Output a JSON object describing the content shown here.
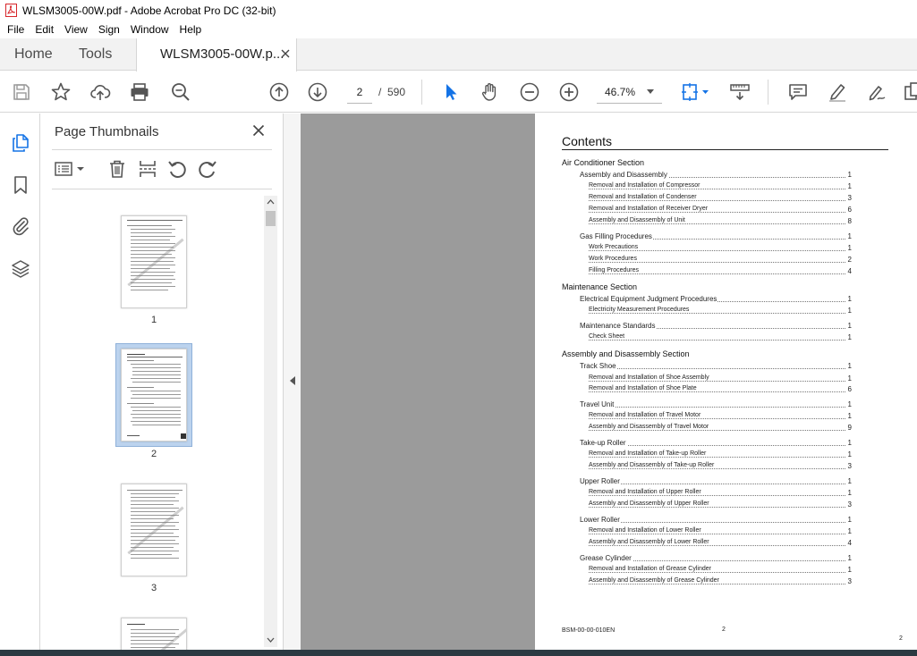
{
  "window": {
    "title": "WLSM3005-00W.pdf - Adobe Acrobat Pro DC (32-bit)"
  },
  "menu": [
    "File",
    "Edit",
    "View",
    "Sign",
    "Window",
    "Help"
  ],
  "tabs": {
    "home": "Home",
    "tools": "Tools",
    "document": "WLSM3005-00W.p..."
  },
  "toolbar": {
    "page_current": "2",
    "page_sep": "/",
    "page_total": "590",
    "zoom": "46.7%"
  },
  "panel": {
    "title": "Page Thumbnails",
    "thumbnails": [
      {
        "label": "1"
      },
      {
        "label": "2",
        "selected": true
      },
      {
        "label": "3"
      }
    ]
  },
  "document": {
    "heading": "Contents",
    "toc": [
      {
        "level": 0,
        "title": "Air Conditioner Section",
        "page": ""
      },
      {
        "level": 1,
        "title": "Assembly and Disassembly",
        "page": "1"
      },
      {
        "level": 2,
        "title": "Removal and Installation of Compressor",
        "page": "1"
      },
      {
        "level": 2,
        "title": "Removal and Installation of Condenser",
        "page": "3"
      },
      {
        "level": 2,
        "title": "Removal and Installation of Receiver Dryer",
        "page": "6"
      },
      {
        "level": 2,
        "title": "Assembly and Disassembly of Unit",
        "page": "8"
      },
      {
        "level": 1,
        "title": "Gas Filling Procedures",
        "page": "1"
      },
      {
        "level": 2,
        "title": "Work Precautions",
        "page": "1"
      },
      {
        "level": 2,
        "title": "Work Procedures",
        "page": "2"
      },
      {
        "level": 2,
        "title": "Filling Procedures",
        "page": "4"
      },
      {
        "level": 0,
        "title": "Maintenance Section",
        "page": ""
      },
      {
        "level": 1,
        "title": "Electrical Equipment Judgment Procedures",
        "page": "1"
      },
      {
        "level": 2,
        "title": "Electricity Measurement Procedures",
        "page": "1"
      },
      {
        "level": 1,
        "title": "Maintenance Standards",
        "page": "1"
      },
      {
        "level": 2,
        "title": "Check Sheet",
        "page": "1"
      },
      {
        "level": 0,
        "title": "Assembly and Disassembly Section",
        "page": ""
      },
      {
        "level": 1,
        "title": "Track Shoe",
        "page": "1"
      },
      {
        "level": 2,
        "title": "Removal and Installation of Shoe Assembly",
        "page": "1"
      },
      {
        "level": 2,
        "title": "Removal and Installation of Shoe Plate",
        "page": "6"
      },
      {
        "level": 1,
        "title": "Travel Unit",
        "page": "1"
      },
      {
        "level": 2,
        "title": "Removal and Installation of Travel Motor",
        "page": "1"
      },
      {
        "level": 2,
        "title": "Assembly and Disassembly of Travel Motor",
        "page": "9"
      },
      {
        "level": 1,
        "title": "Take-up Roller",
        "page": "1"
      },
      {
        "level": 2,
        "title": "Removal and Installation of Take-up Roller",
        "page": "1"
      },
      {
        "level": 2,
        "title": "Assembly and Disassembly of Take-up Roller",
        "page": "3"
      },
      {
        "level": 1,
        "title": "Upper Roller",
        "page": "1"
      },
      {
        "level": 2,
        "title": "Removal and Installation of Upper Roller",
        "page": "1"
      },
      {
        "level": 2,
        "title": "Assembly and Disassembly of Upper Roller",
        "page": "3"
      },
      {
        "level": 1,
        "title": "Lower Roller",
        "page": "1"
      },
      {
        "level": 2,
        "title": "Removal and Installation of Lower Roller",
        "page": "1"
      },
      {
        "level": 2,
        "title": "Assembly and Disassembly of Lower Roller",
        "page": "4"
      },
      {
        "level": 1,
        "title": "Grease Cylinder",
        "page": "1"
      },
      {
        "level": 2,
        "title": "Removal and Installation of Grease Cylinder",
        "page": "1"
      },
      {
        "level": 2,
        "title": "Assembly and Disassembly of Grease Cylinder",
        "page": "3"
      }
    ],
    "footer_code": "BSM-00-00-010EN",
    "footer_page": "2",
    "corner_page": "2"
  },
  "colors": {
    "accent": "#1473e6",
    "selection": "#bcd3ee",
    "canvas": "#9b9b9b",
    "pdf_red": "#d7262b"
  }
}
